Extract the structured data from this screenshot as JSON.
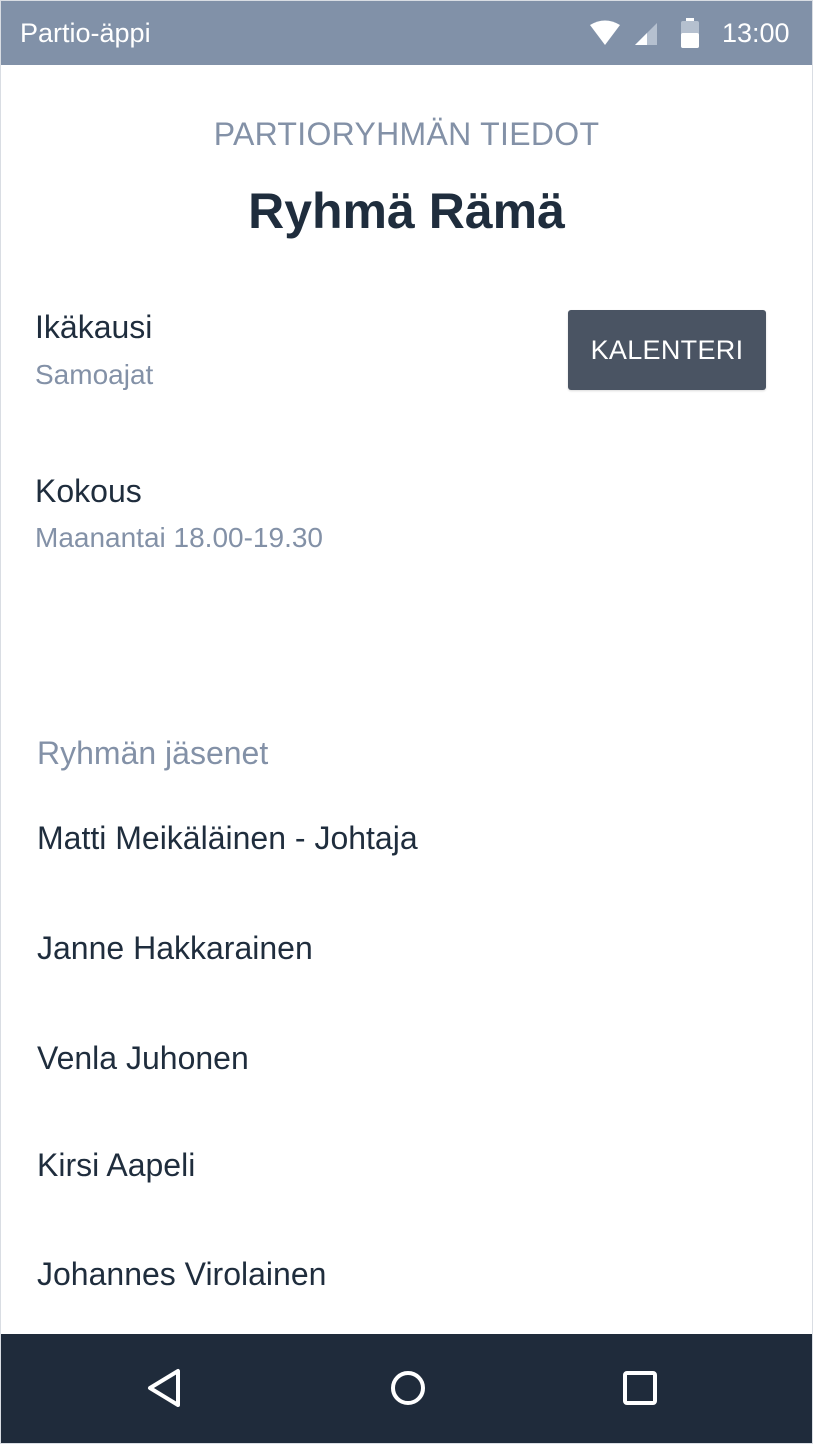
{
  "status_bar": {
    "app_name": "Partio-äppi",
    "time": "13:00",
    "background_color": "#8191a8",
    "icons": [
      "wifi-icon",
      "signal-icon",
      "battery-icon"
    ]
  },
  "header": {
    "subtitle": "PARTIORYHMÄN TIEDOT",
    "title": "Ryhmä Rämä"
  },
  "age_group": {
    "label": "Ikäkausi",
    "value": "Samoajat"
  },
  "calendar_button": {
    "label": "KALENTERI",
    "color": "#4a5463"
  },
  "meeting": {
    "label": "Kokous",
    "value": "Maanantai 18.00-19.30"
  },
  "members": {
    "heading": "Ryhmän jäsenet",
    "items": [
      "Matti Meikäläinen - Johtaja",
      "Janne Hakkarainen",
      "Venla Juhonen",
      "Kirsi Aapeli",
      "Johannes Virolainen"
    ]
  },
  "nav_bar": {
    "background_color": "#1f2b3b",
    "buttons": [
      "back-icon",
      "home-icon",
      "recents-icon"
    ]
  }
}
